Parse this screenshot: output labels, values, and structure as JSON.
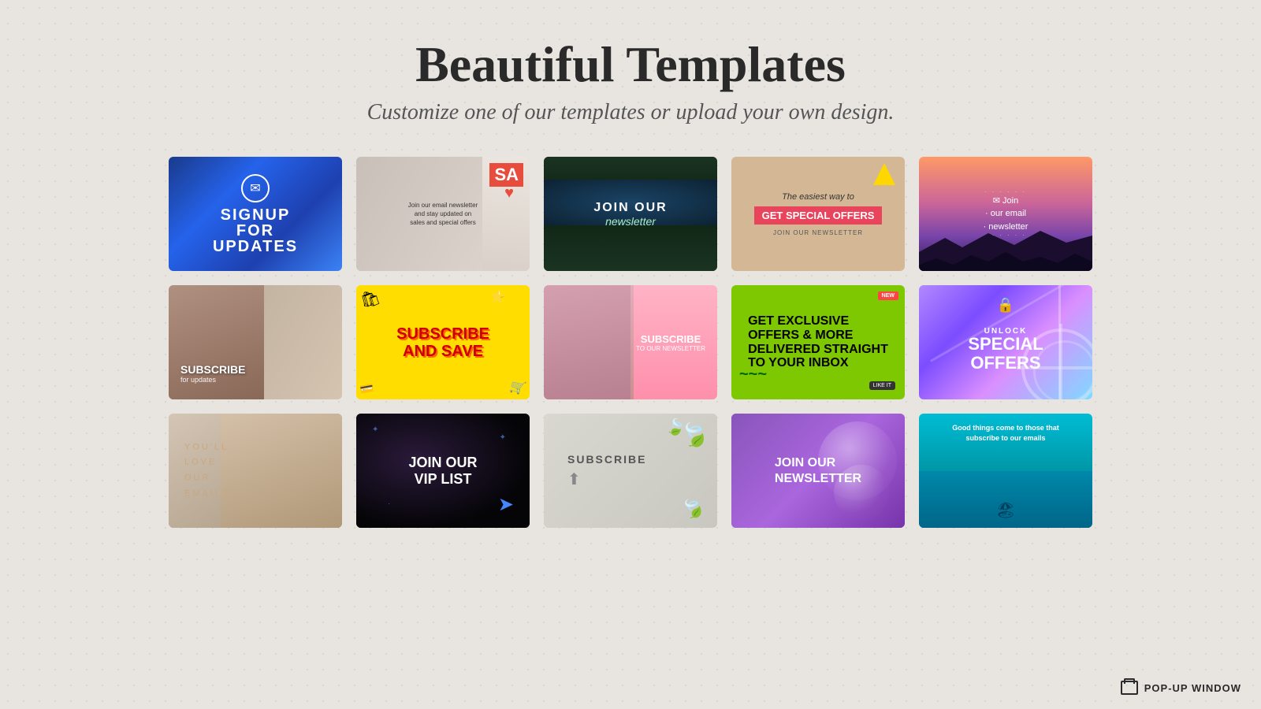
{
  "page": {
    "title": "Beautiful Templates",
    "subtitle": "Customize one of our templates or upload your own design."
  },
  "logo": {
    "icon": "popup-window-icon",
    "text": "POP-UP WINDOW"
  },
  "templates": [
    {
      "id": "card-1",
      "label": "signup-for-updates-card",
      "alt": "Signup for Updates blue marble",
      "title": "SIGNUP FOR UPDATES",
      "theme": "blue-marble"
    },
    {
      "id": "card-2",
      "label": "sale-store-card",
      "alt": "Store sale newsletter",
      "title": "SA Sale - Join newsletter",
      "theme": "store"
    },
    {
      "id": "card-3",
      "label": "join-newsletter-aerial-card",
      "alt": "Join Our Newsletter aerial view",
      "title": "JOIN OUR newsletter",
      "theme": "aerial-dark"
    },
    {
      "id": "card-4",
      "label": "special-offers-beige-card",
      "alt": "The easiest way to GET SPECIAL OFFERS",
      "title": "GET SPECIAL OFFERS",
      "theme": "beige"
    },
    {
      "id": "card-5",
      "label": "join-email-newsletter-mountain-card",
      "alt": "Join email newsletter purple mountains",
      "title": "Join our email newsletter",
      "theme": "purple-mountain"
    },
    {
      "id": "card-6",
      "label": "subscribe-for-updates-fashion-card",
      "alt": "Subscribe for updates fashion",
      "title": "SUBSCRIBE for updates",
      "theme": "fashion"
    },
    {
      "id": "card-7",
      "label": "subscribe-and-save-yellow-card",
      "alt": "Subscribe and Save yellow",
      "title": "SUBSCRIBE AND SAVE",
      "theme": "yellow"
    },
    {
      "id": "card-8",
      "label": "subscribe-newsletter-pink-card",
      "alt": "Subscribe to our newsletter pink",
      "title": "SUBSCRIBE TO OUR NEWSLETTER",
      "theme": "pink"
    },
    {
      "id": "card-9",
      "label": "exclusive-offers-green-card",
      "alt": "Get Exclusive Offers and More green",
      "title": "GET EXCLUSIVE OFFERS & MORE DELIVERED STRAIGHT TO YOUR INBOX",
      "theme": "green"
    },
    {
      "id": "card-10",
      "label": "unlock-special-offers-card",
      "alt": "Unlock Special Offers purple ferris wheel",
      "title": "UNLOCK SPECIAL OFFERS",
      "theme": "purple-ferris"
    },
    {
      "id": "card-11",
      "label": "youll-love-our-emails-card",
      "alt": "You'll love our emails fashion",
      "title": "YOU'LL LOVE OUR EMAILS",
      "theme": "fashion-light"
    },
    {
      "id": "card-12",
      "label": "join-vip-list-card",
      "alt": "Join our VIP List dark",
      "title": "JOIN OUR VIP LIST",
      "theme": "dark"
    },
    {
      "id": "card-13",
      "label": "subscribe-desk-card",
      "alt": "Subscribe desk items",
      "title": "SUBSCRIBE",
      "theme": "desk"
    },
    {
      "id": "card-14",
      "label": "join-newsletter-purple-bubble-card",
      "alt": "Join our Newsletter purple bubble",
      "title": "JOIN OUR NEWSLETTER",
      "theme": "purple-bubble"
    },
    {
      "id": "card-15",
      "label": "good-things-beach-card",
      "alt": "Good things come to those that subscribe beach",
      "title": "Good things come to those that subscribe to our emails",
      "theme": "beach-teal"
    }
  ]
}
